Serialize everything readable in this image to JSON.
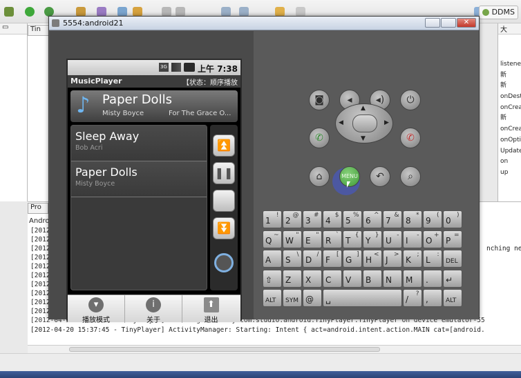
{
  "ide": {
    "ddms_label": "DDMS",
    "editor_tab_label": "Tin",
    "right_tab_label": "大",
    "outline_items": [
      "listener",
      "新",
      "新",
      "onDest",
      "onCrea",
      "新",
      "onCrea",
      "onOpti",
      "Update",
      "on",
      "up"
    ],
    "console_tab_label": "Pro",
    "console_header": "Androi",
    "console_lines": [
      "[2012",
      "[2012",
      "[2012",
      "[2012",
      "[2012",
      "[2012",
      "[2012",
      "[2012",
      "[2012",
      "[2012",
      "[2012-04-20 15:37:47 - TinyPlayer] Starting activity com.studio.android.TinyPlayer.TinyPlayer on device emulator-55",
      "[2012-04-20 15:37:45 - TinyPlayer] ActivityManager: Starting: Intent { act=android.intent.action.MAIN cat=[android."
    ],
    "console_right_snippet": "nching new"
  },
  "emulator": {
    "window_title": "5554:android21",
    "status_time": "上午 7:38",
    "app_title": "MusicPlayer",
    "state_text": "【状态：顺序播放",
    "now_playing": {
      "title": "Paper Dolls",
      "artist": "Misty Boyce",
      "album": "For The Grace O..."
    },
    "songs": [
      {
        "title": "Sleep Away",
        "artist": "Bob Acri"
      },
      {
        "title": "Paper Dolls",
        "artist": "Misty Boyce"
      }
    ],
    "menu_items": [
      {
        "label": "播放模式"
      },
      {
        "label": "关于"
      },
      {
        "label": "退出"
      }
    ],
    "menu_hw_label": "MENU",
    "keyboard": {
      "row1": [
        [
          "1",
          "!"
        ],
        [
          "2",
          "@"
        ],
        [
          "3",
          "#"
        ],
        [
          "4",
          "$"
        ],
        [
          "5",
          "%"
        ],
        [
          "6",
          "^"
        ],
        [
          "7",
          "&"
        ],
        [
          "8",
          "*"
        ],
        [
          "9",
          "("
        ],
        [
          "0",
          ")"
        ]
      ],
      "row2": [
        [
          "Q",
          "~"
        ],
        [
          "W",
          "\""
        ],
        [
          "E",
          "\""
        ],
        [
          "R",
          "`"
        ],
        [
          "T",
          "{"
        ],
        [
          "Y",
          "}"
        ],
        [
          "U",
          "-"
        ],
        [
          "I",
          "-"
        ],
        [
          "O",
          "+"
        ],
        [
          "P",
          "="
        ]
      ],
      "row3": [
        [
          "A",
          ""
        ],
        [
          "S",
          "\\"
        ],
        [
          "D",
          "/"
        ],
        [
          "F",
          "["
        ],
        [
          "G",
          "]"
        ],
        [
          "H",
          "<"
        ],
        [
          "J",
          ">"
        ],
        [
          "K",
          ";"
        ],
        [
          "L",
          ":"
        ],
        [
          "DEL",
          ""
        ]
      ],
      "row4": [
        [
          "⇧",
          ""
        ],
        [
          "Z",
          ""
        ],
        [
          "X",
          ""
        ],
        [
          "C",
          ""
        ],
        [
          "V",
          ""
        ],
        [
          "B",
          ""
        ],
        [
          "N",
          ""
        ],
        [
          "M",
          ""
        ],
        [
          ".",
          ""
        ],
        [
          "↵",
          ""
        ]
      ],
      "row5": [
        [
          "ALT",
          ""
        ],
        [
          "SYM",
          ""
        ],
        [
          "@",
          ""
        ],
        [
          "␣",
          ""
        ],
        [
          "/",
          "?"
        ],
        [
          ",",
          ""
        ],
        [
          "ALT",
          ""
        ]
      ]
    }
  }
}
